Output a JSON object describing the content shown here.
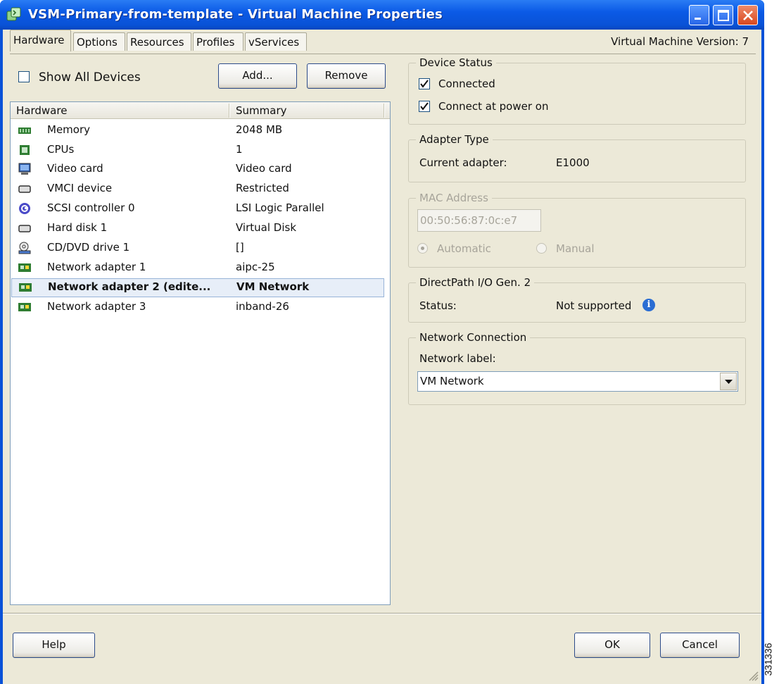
{
  "window": {
    "title": "VSM-Primary-from-template - Virtual Machine Properties",
    "icon": "vm-properties-icon"
  },
  "tabs": [
    {
      "label": "Hardware",
      "active": true
    },
    {
      "label": "Options",
      "active": false
    },
    {
      "label": "Resources",
      "active": false
    },
    {
      "label": "Profiles",
      "active": false
    },
    {
      "label": "vServices",
      "active": false
    }
  ],
  "vm_version": "Virtual Machine Version: 7",
  "left": {
    "show_all_devices_label": "Show All Devices",
    "show_all_devices_checked": false,
    "add_label": "Add...",
    "remove_label": "Remove",
    "columns": {
      "hardware": "Hardware",
      "summary": "Summary"
    },
    "rows": [
      {
        "name": "Memory",
        "summary": "2048 MB",
        "icon": "memory-icon"
      },
      {
        "name": "CPUs",
        "summary": "1",
        "icon": "cpu-icon"
      },
      {
        "name": "Video card",
        "summary": "Video card",
        "icon": "monitor-icon"
      },
      {
        "name": "VMCI device",
        "summary": "Restricted",
        "icon": "device-icon"
      },
      {
        "name": "SCSI controller 0",
        "summary": "LSI Logic Parallel",
        "icon": "scsi-icon"
      },
      {
        "name": "Hard disk 1",
        "summary": "Virtual Disk",
        "icon": "disk-icon"
      },
      {
        "name": "CD/DVD drive 1",
        "summary": "[]",
        "icon": "cdrom-icon"
      },
      {
        "name": "Network adapter 1",
        "summary": "aipc-25",
        "icon": "nic-icon"
      },
      {
        "name": "Network adapter 2 (edite...",
        "summary": "VM Network",
        "icon": "nic-icon",
        "selected": true
      },
      {
        "name": "Network adapter 3",
        "summary": "inband-26",
        "icon": "nic-icon"
      }
    ]
  },
  "device_status": {
    "title": "Device Status",
    "connected_label": "Connected",
    "connected_checked": true,
    "connect_at_power_on_label": "Connect at power on",
    "connect_at_power_on_checked": true
  },
  "adapter_type": {
    "title": "Adapter Type",
    "current_label": "Current adapter:",
    "current_value": "E1000"
  },
  "mac_address": {
    "title": "MAC Address",
    "value": "00:50:56:87:0c:e7",
    "automatic_label": "Automatic",
    "manual_label": "Manual",
    "mode": "Automatic"
  },
  "directpath": {
    "title": "DirectPath I/O Gen. 2",
    "status_label": "Status:",
    "status_value": "Not supported"
  },
  "network_connection": {
    "title": "Network Connection",
    "label": "Network label:",
    "selected": "VM Network"
  },
  "footer": {
    "help_label": "Help",
    "ok_label": "OK",
    "cancel_label": "Cancel"
  },
  "figure_id": "331336"
}
